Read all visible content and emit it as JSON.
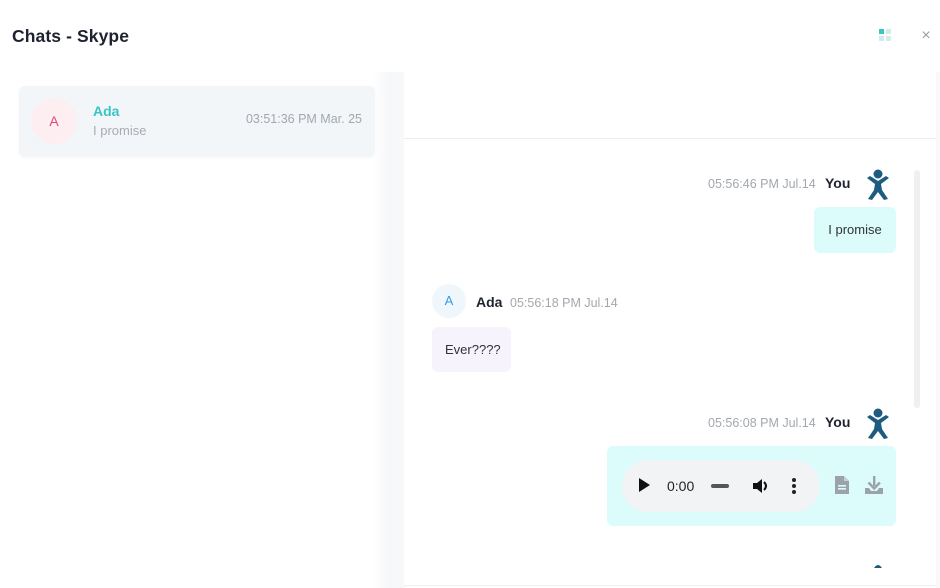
{
  "window": {
    "title": "Chats - Skype",
    "grid_icon": "grid-icon",
    "close_icon": "close-icon",
    "close_glyph": "×"
  },
  "chat_list": [
    {
      "avatar_letter": "A",
      "name": "Ada",
      "preview": "I promise",
      "timestamp": "03:51:36 PM Mar. 25",
      "avatar_color": "#e0487a",
      "name_color": "#3cc4c4"
    }
  ],
  "conversation": {
    "messages": [
      {
        "sender": "You",
        "timestamp": "05:56:46 PM Jul.14",
        "type": "text",
        "text": "I promise",
        "avatar_icon": "person-icon"
      },
      {
        "sender": "Ada",
        "avatar_letter": "A",
        "timestamp": "05:56:18 PM Jul.14",
        "type": "text",
        "text": "Ever????"
      },
      {
        "sender": "You",
        "timestamp": "05:56:08 PM Jul.14",
        "type": "audio",
        "audio": {
          "current_time": "0:00",
          "play_icon": "play-icon",
          "volume_icon": "volume-icon",
          "more_icon": "more-options-icon"
        },
        "actions": [
          "file-icon",
          "download-icon"
        ],
        "avatar_icon": "person-icon"
      }
    ]
  },
  "colors": {
    "accent": "#3cc4c4",
    "you_bubble": "#dcfbfb",
    "them_bubble": "#f6f3fd",
    "person_icon": "#1e5b80"
  }
}
